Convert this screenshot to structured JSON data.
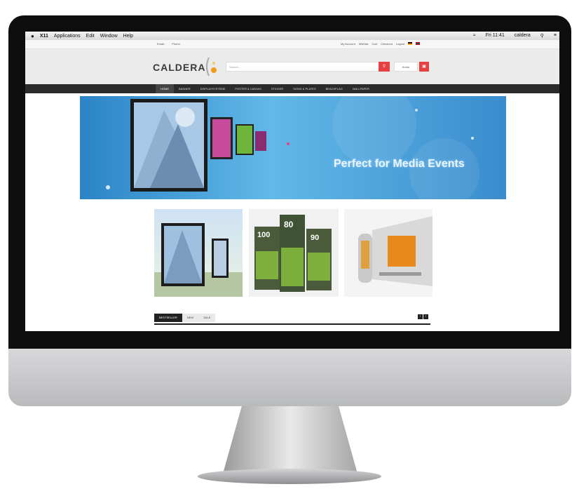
{
  "menubar": {
    "apple_icon": "apple-icon",
    "items": [
      "X11",
      "Applications",
      "Edit",
      "Window",
      "Help"
    ],
    "clock": "Fri 11:41",
    "user": "caldera"
  },
  "infobar": {
    "email_label": "Email:",
    "phone_label": "Phone:",
    "links": [
      "My Account",
      "Wishlist",
      "Cart",
      "Checkout",
      "Logout"
    ]
  },
  "header": {
    "logo": "CALDERA",
    "search_placeholder": "Search...",
    "account_label": "Konto",
    "search_icon": "search-icon",
    "cart_icon": "cart-icon"
  },
  "nav": {
    "items": [
      "HOME",
      "BANNER",
      "DISPLAYSYSTEME",
      "POSTER & CANVAS",
      "STICKER",
      "SIGNS & PLATES",
      "BEACHFLAG",
      "WALLPAPER"
    ],
    "active_index": 0
  },
  "hero": {
    "headline": "Perfect for Media Events"
  },
  "tabs": {
    "items": [
      "BESTSELLER",
      "NEW",
      "SALE"
    ],
    "active_index": 0
  },
  "colors": {
    "accent": "#e84040",
    "nav_bg": "#2b2b2b",
    "hero_blue": "#3a9ad8"
  }
}
